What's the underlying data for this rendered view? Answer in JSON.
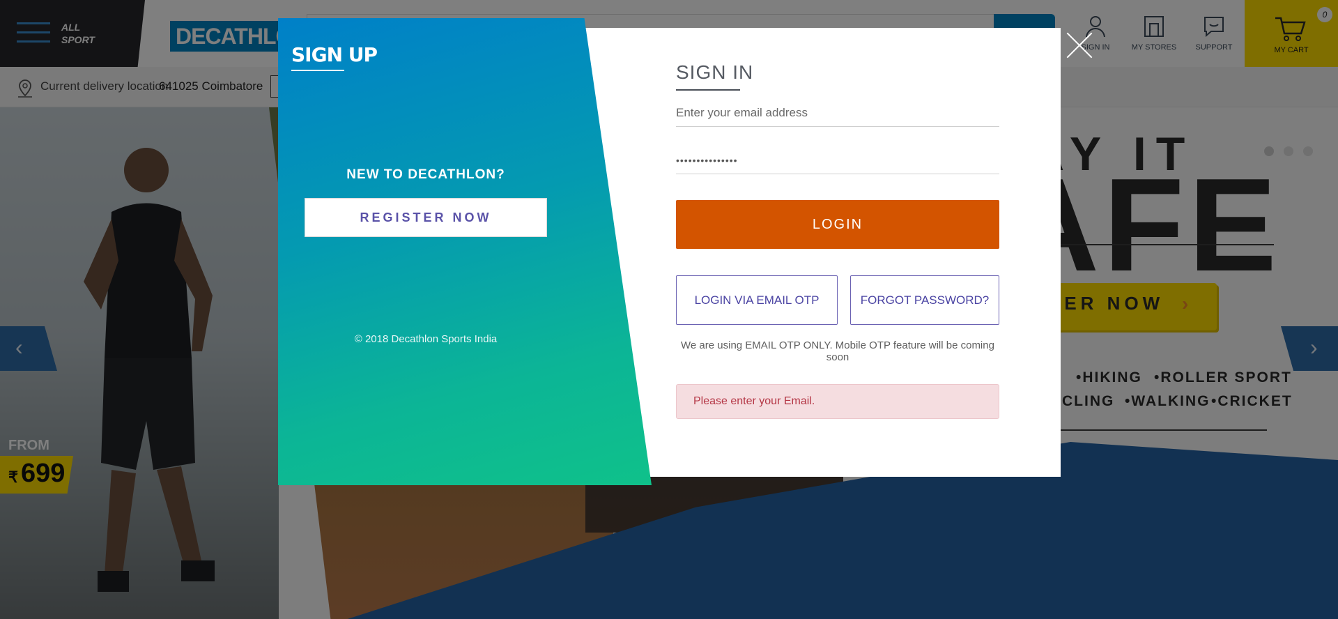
{
  "header": {
    "all_sport_label": "ALL\nSPORT",
    "logo_text": "DECATHLON",
    "nav": [
      {
        "label": "SIGN IN",
        "icon": "user-icon"
      },
      {
        "label": "MY STORES",
        "icon": "store-icon"
      },
      {
        "label": "SUPPORT",
        "icon": "chat-icon"
      }
    ],
    "cart": {
      "label": "MY CART",
      "count": "0",
      "icon": "cart-icon"
    }
  },
  "delivery": {
    "label": "Current delivery location",
    "value": "641025 Coimbatore"
  },
  "hero": {
    "from_label": "FROM",
    "currency": "₹",
    "price": "699",
    "headline_1": "AY IT",
    "headline_2": "AFE",
    "cta": "VER NOW",
    "sports": [
      "•HIKING",
      "•ROLLER SPORT",
      "CLING",
      "•WALKING",
      "•CRICKET"
    ]
  },
  "modal": {
    "signup": {
      "title": "SIGN UP",
      "prompt": "NEW TO DECATHLON?",
      "register_label": "REGISTER NOW",
      "copyright": "© 2018 Decathlon Sports India"
    },
    "signin": {
      "title": "SIGN IN",
      "email_placeholder": "Enter your email address",
      "password_value": "•••••••••••••••",
      "login_label": "LOGIN",
      "otp_label": "LOGIN VIA EMAIL OTP",
      "forgot_label": "FORGOT PASSWORD?",
      "otp_note": "We are using EMAIL OTP ONLY. Mobile OTP feature will be coming soon",
      "error_message": "Please enter your Email."
    }
  },
  "colors": {
    "brand_blue": "#0082c3",
    "login_orange": "#d35400",
    "accent_yellow": "#ffdd00",
    "error_bg": "#f5dde0"
  }
}
